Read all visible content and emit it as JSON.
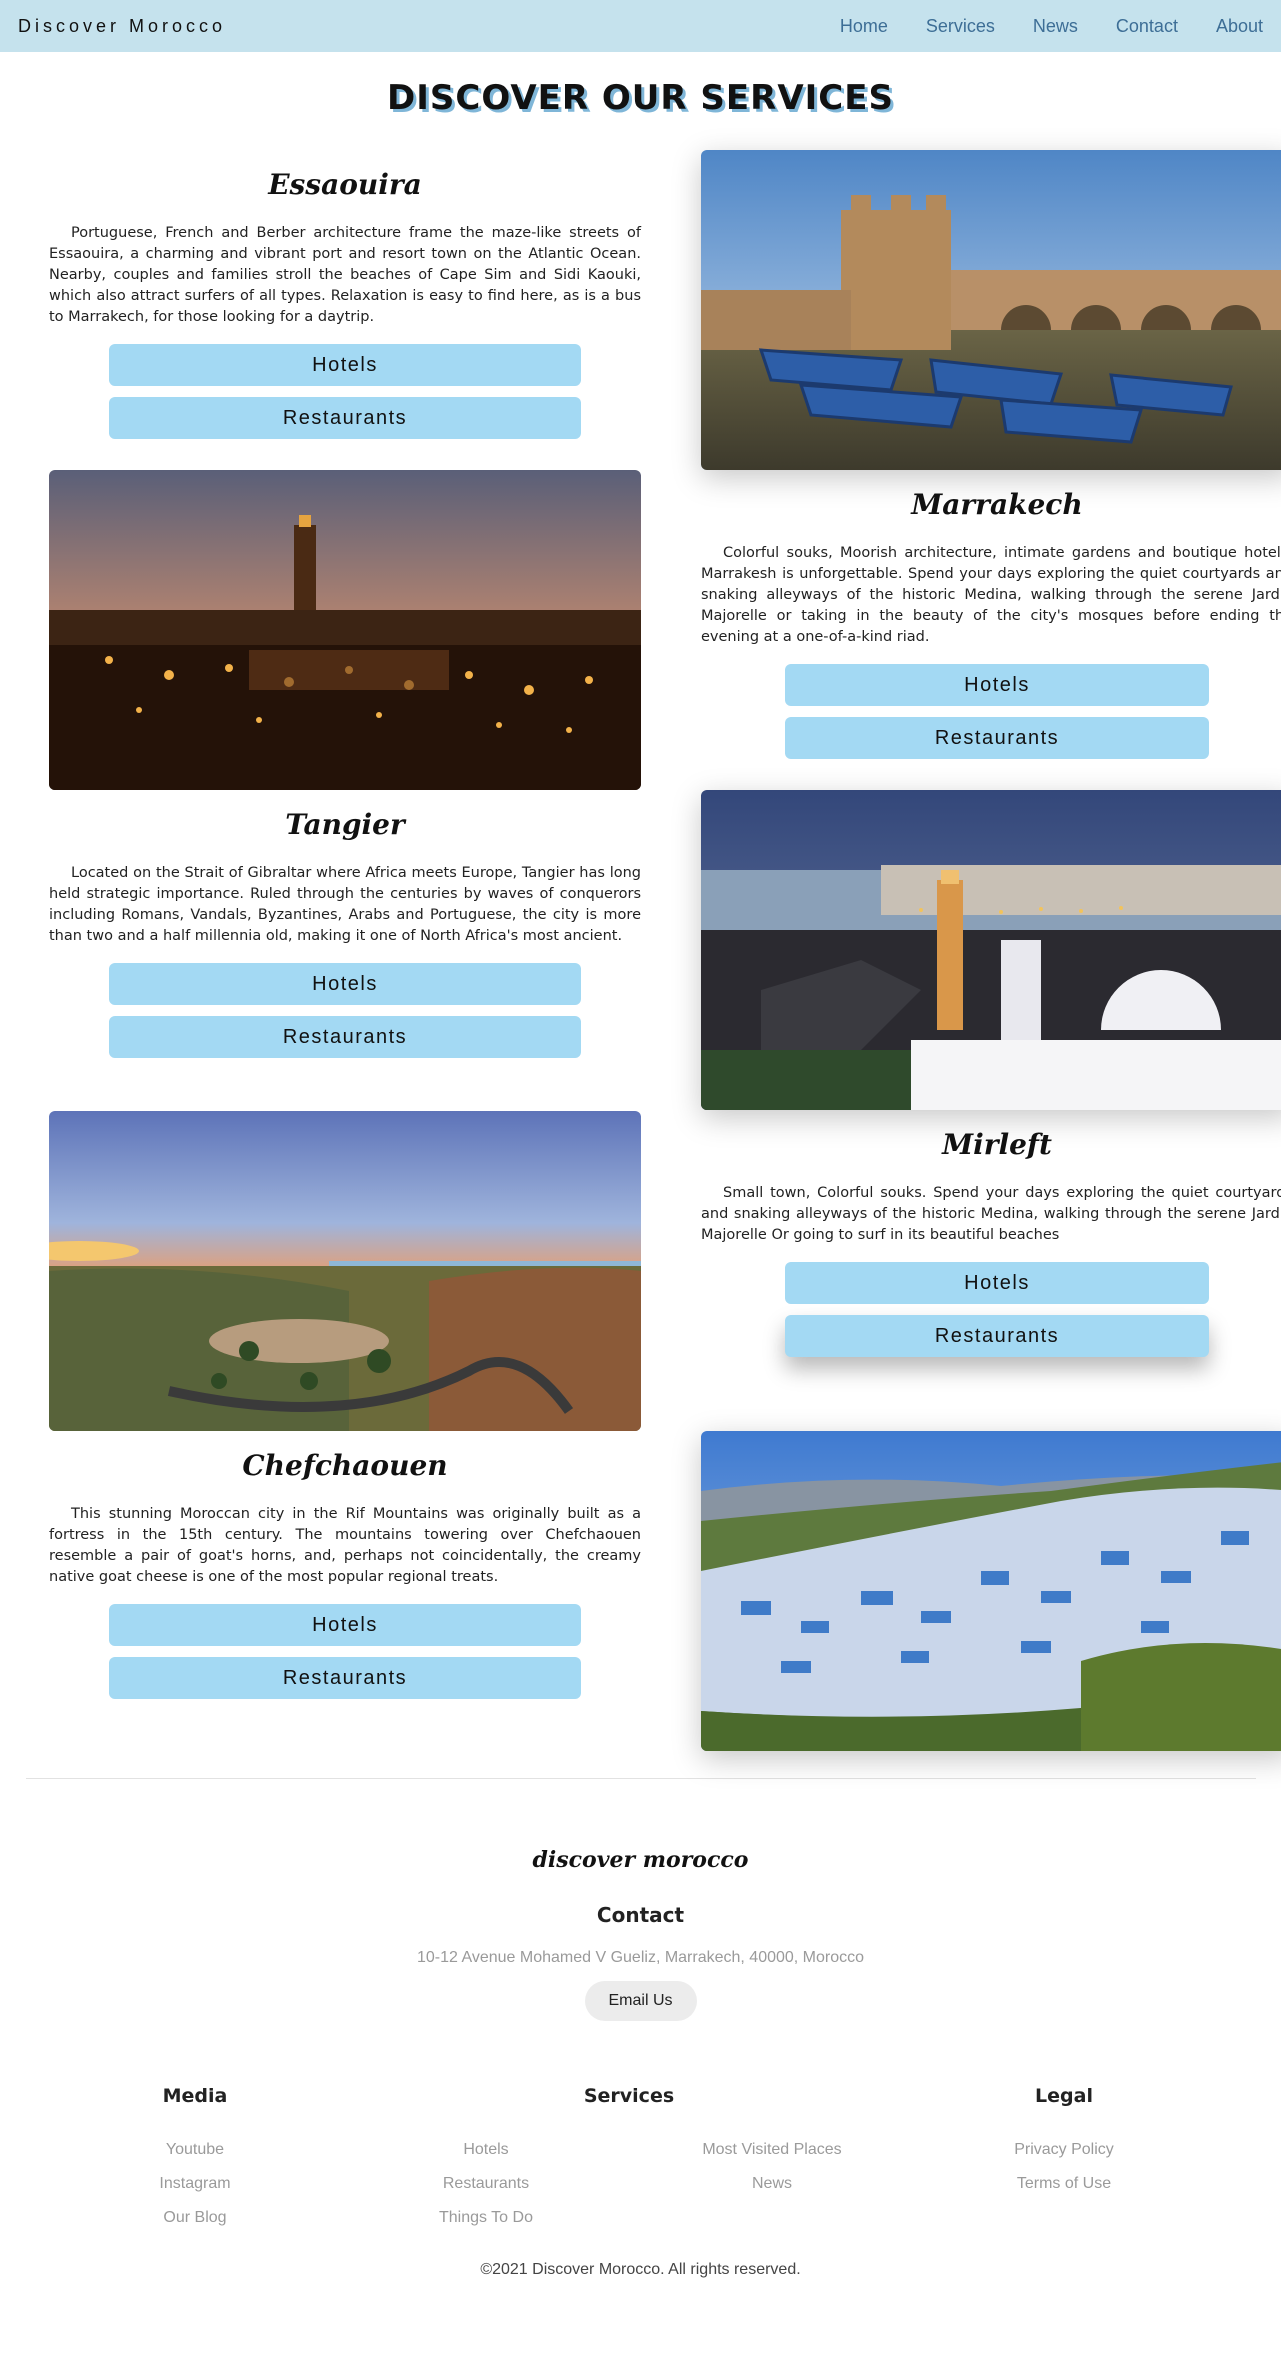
{
  "nav": {
    "brand": "Discover Morocco",
    "links": [
      "Home",
      "Services",
      "News",
      "Contact",
      "About"
    ]
  },
  "page_title": "DISCOVER OUR SERVICES",
  "cities": [
    {
      "name": "Essaouira",
      "description": "Portuguese, French and Berber architecture frame the maze-like streets of Essaouira, a charming and vibrant port and resort town on the Atlantic Ocean. Nearby, couples and families stroll the beaches of Cape Sim and Sidi Kaouki, which also attract surfers of all types. Relaxation is easy to find here, as is a bus to Marrakech, for those looking for a daytrip.",
      "hotels_label": "Hotels",
      "restaurants_label": "Restaurants"
    },
    {
      "name": "Marrakech",
      "description": "Colorful souks, Moorish architecture, intimate gardens and boutique hotels. Marrakesh is unforgettable. Spend your days exploring the quiet courtyards and snaking alleyways of the historic Medina, walking through the serene Jardin Majorelle or taking in the beauty of the city's mosques before ending the evening at a one-of-a-kind riad.",
      "hotels_label": "Hotels",
      "restaurants_label": "Restaurants"
    },
    {
      "name": "Tangier",
      "description": "Located on the Strait of Gibraltar where Africa meets Europe, Tangier has long held strategic importance. Ruled through the centuries by waves of conquerors including Romans, Vandals, Byzantines, Arabs and Portuguese, the city is more than two and a half millennia old, making it one of North Africa's most ancient.",
      "hotels_label": "Hotels",
      "restaurants_label": "Restaurants"
    },
    {
      "name": "Mirleft",
      "description": "Small town, Colorful souks. Spend your days exploring the quiet courtyards and snaking alleyways of the historic Medina, walking through the serene Jardin Majorelle Or going to surf in its beautiful beaches",
      "hotels_label": "Hotels",
      "restaurants_label": "Restaurants"
    },
    {
      "name": "Chefchaouen",
      "description": "This stunning Moroccan city in the Rif Mountains was originally built as a fortress in the 15th century. The mountains towering over Chefchaouen resemble a pair of goat's horns, and, perhaps not coincidentally, the creamy native goat cheese is one of the most popular regional treats.",
      "hotels_label": "Hotels",
      "restaurants_label": "Restaurants"
    }
  ],
  "footer": {
    "brand": "discover morocco",
    "contact_heading": "Contact",
    "address": "10-12 Avenue Mohamed V Gueliz, Marrakech, 40000, Morocco",
    "email_label": "Email Us",
    "media": {
      "heading": "Media",
      "links": [
        "Youtube",
        "Instagram",
        "Our Blog"
      ]
    },
    "services": {
      "heading": "Services",
      "col1": [
        "Hotels",
        "Restaurants",
        "Things To Do"
      ],
      "col2": [
        "Most Visited Places",
        "News"
      ]
    },
    "legal": {
      "heading": "Legal",
      "links": [
        "Privacy Policy",
        "Terms of Use"
      ]
    },
    "copyright": "©2021 Discover Morocco. All rights reserved."
  },
  "colors": {
    "nav_bg": "#c5e2ed",
    "nav_link": "#3d6e96",
    "button_bg": "#a3d9f3",
    "title_shadow": "#7fb6d8"
  }
}
